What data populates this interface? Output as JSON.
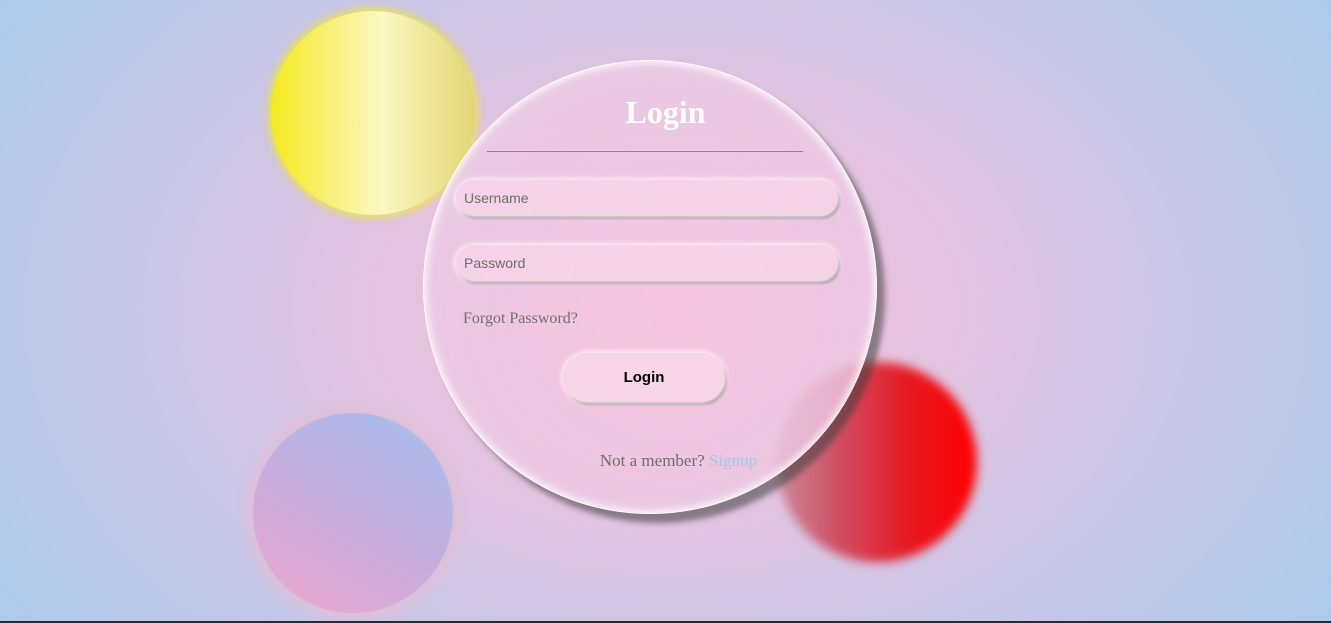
{
  "login_card": {
    "title": "Login",
    "username_placeholder": "Username",
    "password_placeholder": "Password",
    "forgot_password": "Forgot Password?",
    "login_button": "Login",
    "signup_prompt": "Not a member?",
    "signup_link": "Signup"
  },
  "colors": {
    "orb_yellow": "#f6ea1e",
    "orb_red": "#ff0000",
    "orb_blue_pink": "#c5addf",
    "title_text": "#ffffff",
    "link": "#a8c6e6"
  }
}
